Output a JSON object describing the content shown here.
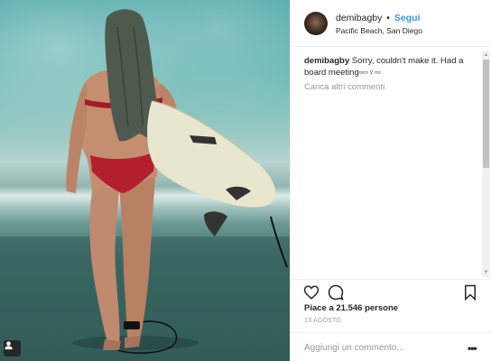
{
  "post": {
    "username": "demibagby",
    "follow_label": "Segui",
    "separator": "•",
    "location": "Pacific Beach, San Diego",
    "caption_user": "demibagby",
    "caption_text": "Sorry, couldn't make it. Had a board meeting▫▫▫♀▫▫",
    "load_more_comments": "Carica altri commenti",
    "likes_text": "Piace a 21.546 persone",
    "date": "13 AGOSTO",
    "comment_placeholder": "Aggiungi un commento...",
    "options_label": "•••"
  },
  "icons": {
    "like": "heart-icon",
    "comment": "comment-icon",
    "save": "bookmark-icon",
    "tag": "user-tag-icon",
    "options": "more-options-icon"
  },
  "colors": {
    "follow": "#3897f0",
    "muted": "#999999",
    "text": "#262626",
    "border": "#efefef"
  }
}
